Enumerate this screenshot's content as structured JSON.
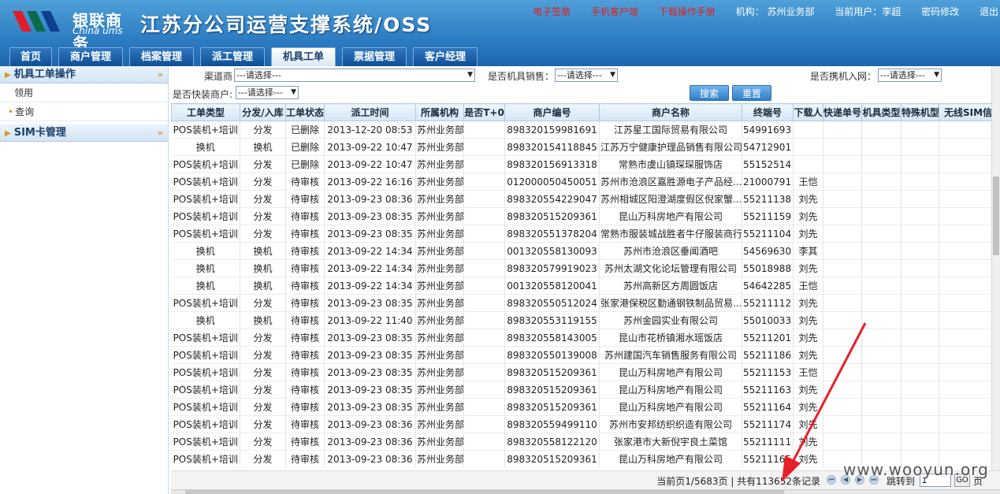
{
  "header": {
    "logo_cn": "银联商务",
    "logo_en": "China ums",
    "title": "江苏分公司运营支撑系统/OSS",
    "links": {
      "esign": "电子签章",
      "mobile": "手机客户端",
      "manual": "下载操作手册",
      "org": "机构：  苏州业务部",
      "user": "当前用户：李超",
      "password": "密码修改",
      "logout": "退出"
    }
  },
  "nav": [
    "首页",
    "商户管理",
    "档案管理",
    "派工管理",
    "机具工单",
    "票据管理",
    "客户经理"
  ],
  "sidebar": {
    "section1": "机具工单操作",
    "item1": "领用",
    "item2": "查询",
    "section2": "SIM卡管理"
  },
  "filters": {
    "channel_label": "渠道商",
    "channel_value": "---请选择---",
    "pos_sale_label": "是否机具销售：",
    "pos_sale_value": "---请选择---",
    "portable_label": "是否携机入网：",
    "portable_value": "---请选择---",
    "fast_label": "是否快装商户:",
    "fast_value": "---请选择---",
    "search": "搜索",
    "reset": "重置"
  },
  "table": {
    "columns": [
      "工单类型",
      "分发/入库",
      "工单状态",
      "派工时间",
      "所属机构",
      "是否T+0",
      "商户编号",
      "商户名称",
      "终端号",
      "下载人",
      "快递单号",
      "机具类型",
      "特殊机型",
      "无线SIM信息"
    ],
    "rows": [
      [
        "POS装机+培训",
        "分发",
        "已删除",
        "2013-12-20 08:53",
        "苏州业务部",
        "",
        "898320159981691",
        "江苏星工国际贸易有限公司",
        "54991693",
        ""
      ],
      [
        "换机",
        "换机",
        "已删除",
        "2013-09-22 10:47",
        "苏州业务部",
        "",
        "898320154118845",
        "江苏万宁健康护理品销售有限公司",
        "54712901",
        ""
      ],
      [
        "POS装机+培训",
        "分发",
        "已删除",
        "2013-09-22 10:47",
        "苏州业务部",
        "",
        "898320156913318",
        "常熟市虞山镇琛琛服饰店",
        "55152514",
        ""
      ],
      [
        "POS装机+培训",
        "分发",
        "待审核",
        "2013-09-22 16:16",
        "苏州业务部",
        "",
        "012000050450051",
        "苏州市沧浪区嘉胜源电子产品经...",
        "21000791",
        "王恺"
      ],
      [
        "POS装机+培训",
        "分发",
        "待审核",
        "2013-09-23 08:36",
        "苏州业务部",
        "",
        "898320554229047",
        "苏州相城区阳澄湖度假区倪家蟹...",
        "55211138",
        "刘先"
      ],
      [
        "POS装机+培训",
        "分发",
        "待审核",
        "2013-09-23 08:35",
        "苏州业务部",
        "",
        "898320515209361",
        "昆山万科房地产有限公司",
        "55211159",
        "刘先"
      ],
      [
        "POS装机+培训",
        "分发",
        "待审核",
        "2013-09-23 08:35",
        "苏州业务部",
        "",
        "898320551378204",
        "常熟市服装城战胜者牛仔服装商行",
        "55211104",
        "刘先"
      ],
      [
        "换机",
        "换机",
        "待审核",
        "2013-09-22 14:34",
        "苏州业务部",
        "",
        "001320558130093",
        "苏州市沧浪区垂闻酒吧",
        "54569630",
        "李其"
      ],
      [
        "换机",
        "换机",
        "待审核",
        "2013-09-22 14:34",
        "苏州业务部",
        "",
        "898320579919023",
        "苏州太湖文化论坛管理有限公司",
        "55018988",
        "刘先"
      ],
      [
        "换机",
        "换机",
        "待审核",
        "2013-09-22 14:34",
        "苏州业务部",
        "",
        "001320558120041",
        "苏州高新区方周圆饭店",
        "54642285",
        "王恺"
      ],
      [
        "POS装机+培训",
        "分发",
        "待审核",
        "2013-09-23 08:35",
        "苏州业务部",
        "",
        "898320550512024",
        "张家港保税区勤通钢铁制品贸易...",
        "55211112",
        "刘先"
      ],
      [
        "换机",
        "换机",
        "待审核",
        "2013-09-22 11:40",
        "苏州业务部",
        "",
        "898320553119155",
        "苏州金园实业有限公司",
        "55010033",
        "刘先"
      ],
      [
        "POS装机+培训",
        "分发",
        "待审核",
        "2013-09-23 08:35",
        "苏州业务部",
        "",
        "898320558143005",
        "昆山市花桥镇湘水瑶饭店",
        "55211201",
        "刘先"
      ],
      [
        "POS装机+培训",
        "分发",
        "待审核",
        "2013-09-23 08:35",
        "苏州业务部",
        "",
        "898320550139008",
        "苏州建国汽车销售服务有限公司",
        "55211186",
        "刘先"
      ],
      [
        "POS装机+培训",
        "分发",
        "待审核",
        "2013-09-23 08:35",
        "苏州业务部",
        "",
        "898320515209361",
        "昆山万科房地产有限公司",
        "55211153",
        "王恺"
      ],
      [
        "POS装机+培训",
        "分发",
        "待审核",
        "2013-09-23 08:35",
        "苏州业务部",
        "",
        "898320515209361",
        "昆山万科房地产有限公司",
        "55211163",
        "刘先"
      ],
      [
        "POS装机+培训",
        "分发",
        "待审核",
        "2013-09-23 08:35",
        "苏州业务部",
        "",
        "898320515209361",
        "昆山万科房地产有限公司",
        "55211164",
        "刘先"
      ],
      [
        "POS装机+培训",
        "分发",
        "待审核",
        "2013-09-23 08:36",
        "苏州业务部",
        "",
        "898320559499110",
        "苏州市安邦纺织织造有限公司",
        "55211174",
        "刘先"
      ],
      [
        "POS装机+培训",
        "分发",
        "待审核",
        "2013-09-23 08:36",
        "苏州业务部",
        "",
        "898320558122120",
        "张家港市大新倪宇良土菜馆",
        "55211111",
        "刘先"
      ],
      [
        "POS装机+培训",
        "分发",
        "待审核",
        "2013-09-23 08:36",
        "苏州业务部",
        "",
        "898320515209361",
        "昆山万科房地产有限公司",
        "55211165",
        "刘先"
      ]
    ]
  },
  "pager": {
    "info": "当前页1/5683页 | 共有113652条记录",
    "jump_label": "跳转到",
    "jump_value": "1",
    "go": "GO",
    "suffix": "页"
  },
  "watermark": "www.wooyun.org",
  "colors": {
    "header_blue": "#2f7fc4",
    "nav_active": "#ffffff",
    "link_red": "#e02020",
    "annotation_red": "#e8202a"
  }
}
